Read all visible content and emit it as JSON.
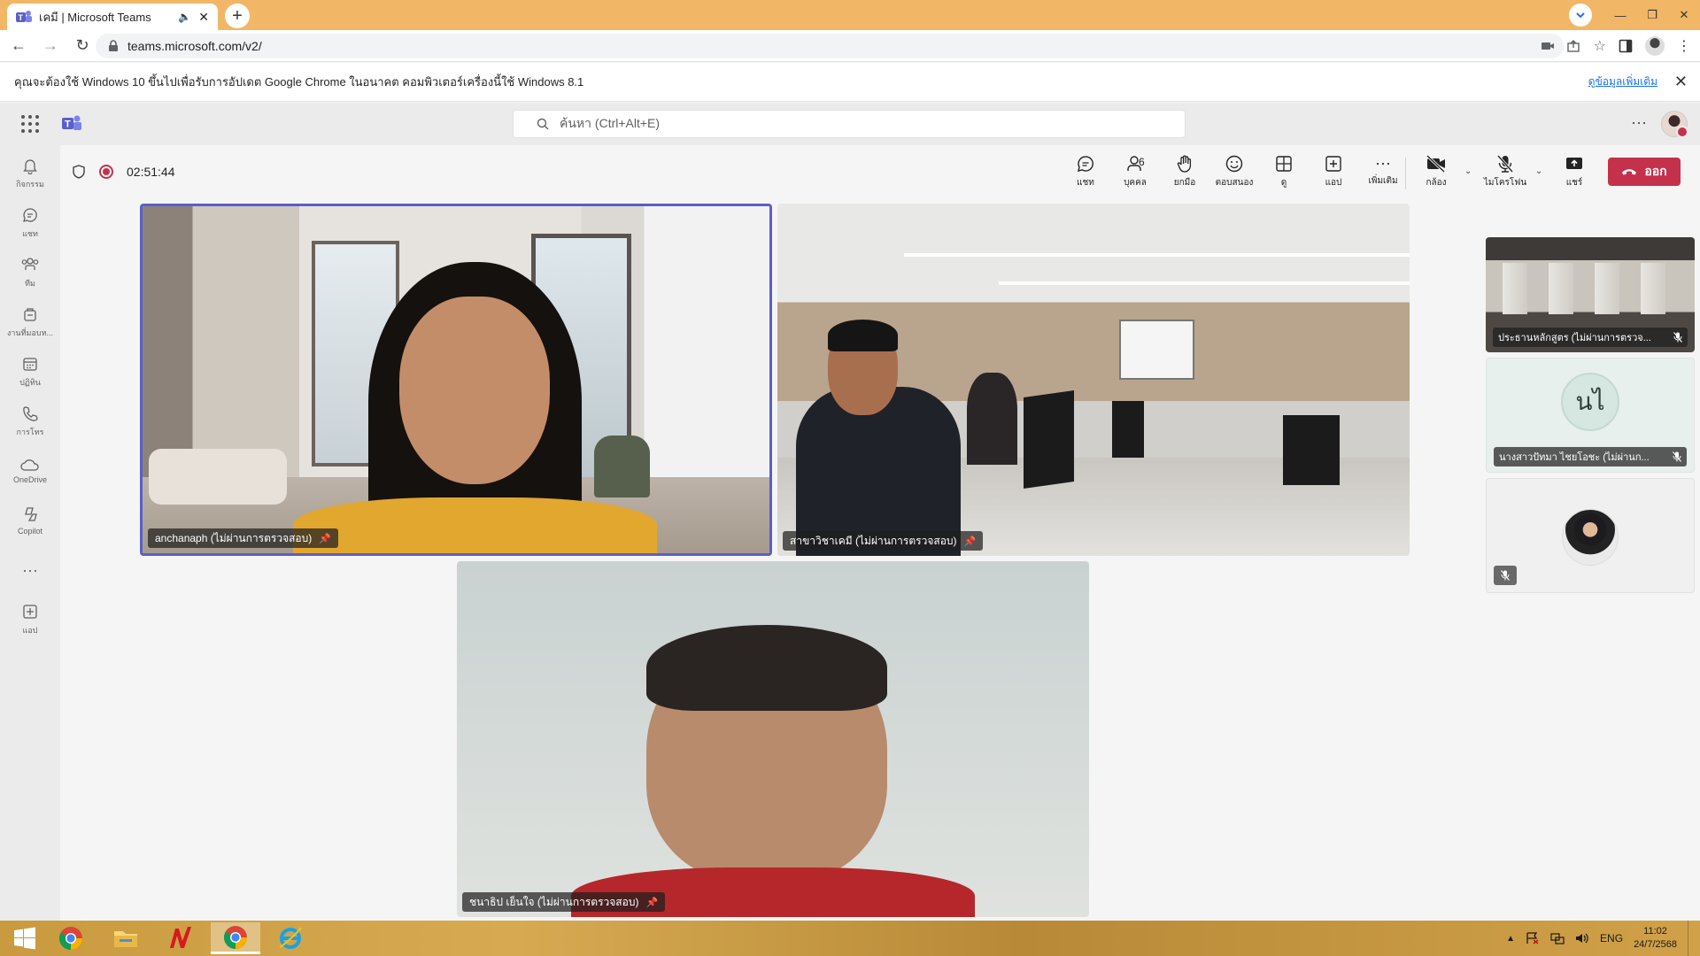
{
  "browser": {
    "tab_title": "เคมี | Microsoft Teams",
    "url": "teams.microsoft.com/v2/",
    "infobar_text": "คุณจะต้องใช้ Windows 10 ขึ้นไปเพื่อรับการอัปเดต Google Chrome ในอนาคต คอมพิวเตอร์เครื่องนี้ใช้ Windows 8.1",
    "infobar_link": "ดูข้อมูลเพิ่มเติม"
  },
  "teams_header": {
    "search_placeholder": "ค้นหา (Ctrl+Alt+E)"
  },
  "rail": {
    "items": [
      {
        "label": "กิจกรรม",
        "icon": "bell-icon"
      },
      {
        "label": "แชท",
        "icon": "chat-icon"
      },
      {
        "label": "ทีม",
        "icon": "teams-icon"
      },
      {
        "label": "งานที่มอบห...",
        "icon": "assignments-icon"
      },
      {
        "label": "ปฏิทิน",
        "icon": "calendar-icon"
      },
      {
        "label": "การโทร",
        "icon": "phone-icon"
      },
      {
        "label": "OneDrive",
        "icon": "onedrive-icon"
      },
      {
        "label": "Copilot",
        "icon": "copilot-icon"
      },
      {
        "label": "",
        "icon": "more-icon"
      },
      {
        "label": "แอป",
        "icon": "apps-icon"
      }
    ]
  },
  "meeting": {
    "timer": "02:51:44",
    "toolbar": {
      "chat": "แชท",
      "people": "บุคคล",
      "people_count": "6",
      "raise": "ยกมือ",
      "react": "ตอบสนอง",
      "view": "ดู",
      "apps": "แอป",
      "more": "เพิ่มเติม",
      "camera": "กล้อง",
      "mic": "ไมโครโฟน",
      "share": "แชร์",
      "leave": "ออก"
    },
    "accent_color": "#5b5fc7",
    "leave_color": "#c4314b",
    "tiles": [
      {
        "name": "anchanaph (ไม่ผ่านการตรวจสอบ)"
      },
      {
        "name": "สาขาวิชาเคมี (ไม่ผ่านการตรวจสอบ)"
      },
      {
        "name": "ชนาธิป เย็นใจ (ไม่ผ่านการตรวจสอบ)"
      }
    ],
    "gallery": [
      {
        "name": "ประธานหลักสูตร (ไม่ผ่านการตรวจ...",
        "muted": true
      },
      {
        "name": "นางสาวปัทมา ไชยโอชะ (ไม่ผ่านก...",
        "initials": "นไ",
        "muted": true
      },
      {
        "name": "",
        "muted": true
      }
    ]
  },
  "taskbar": {
    "lang": "ENG",
    "time": "11:02",
    "date": "24/7/2568"
  }
}
